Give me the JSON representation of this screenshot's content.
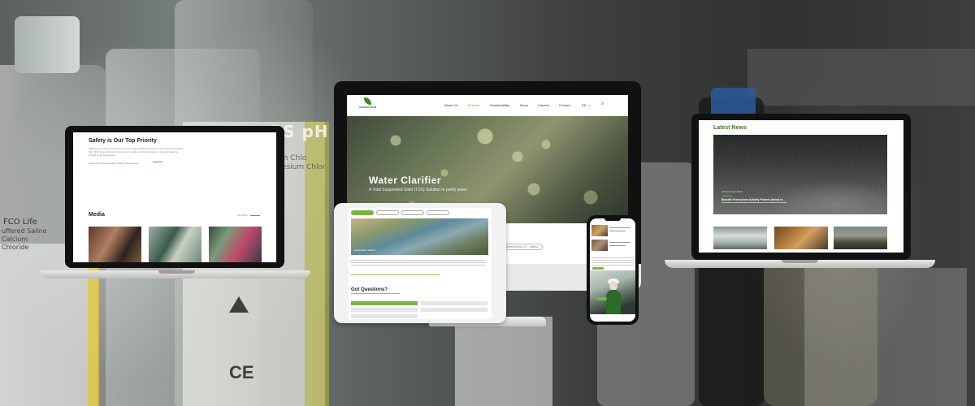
{
  "left_laptop": {
    "section_title": "Safety is Our Top Priority",
    "description": "Working in a safe environment is most fundamental element for a Greenchem Industrial Sdn. Bhd. Greenchem's Commitment to safe working practices to demonstrated we provide to all employees.",
    "learn_more_link": "Learn More About Health, Safety, Environment",
    "media_title": "Media",
    "see_all_link": "See More",
    "media_thumbnails": [
      "event-photo",
      "factory-photo",
      "staff-photo"
    ]
  },
  "monitor": {
    "logo_text": "GREENCHEM",
    "nav_items": [
      "About Us",
      "Product",
      "Sustainability",
      "News",
      "Careers",
      "Contact",
      "EN"
    ],
    "active_nav": "Product",
    "hero_title": "Water Clarifier",
    "hero_subtitle": "A Total Suspended Solid (TSS) Solution to purify water.",
    "pill_label": "Ammonia Sol 07 - Tables"
  },
  "tablet": {
    "tabs": [
      "",
      "",
      "",
      ""
    ],
    "hero_caption": "Sustainability Initiatives",
    "contact_heading": "Got Questions?"
  },
  "right_laptop": {
    "section_title": "Latest News",
    "featured_date": "20 December 2024",
    "featured_category": "Highlights",
    "featured_headline": "Biocide Greenchem Activity Powers Ahead In..."
  },
  "colors": {
    "brand_green": "#6aa32a",
    "accent_green": "#7cb342",
    "dark_green": "#3e7a1e"
  }
}
